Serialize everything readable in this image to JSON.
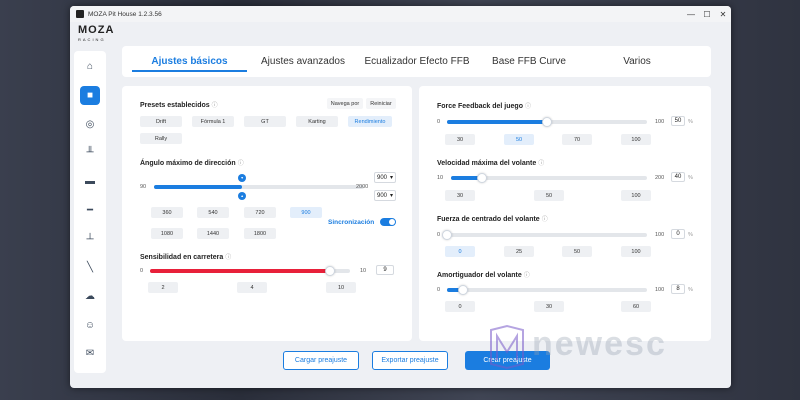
{
  "window": {
    "title": "MOZA Pit House 1.2.3.56"
  },
  "logo": {
    "brand": "MOZA",
    "sub": "RACING"
  },
  "sidebar": {
    "items": [
      {
        "icon": "home-icon",
        "glyph": "⌂"
      },
      {
        "icon": "wheelbase-icon",
        "glyph": "■"
      },
      {
        "icon": "steering-wheel-icon",
        "glyph": "◎"
      },
      {
        "icon": "pedals-icon",
        "glyph": "╨"
      },
      {
        "icon": "dashboard-icon",
        "glyph": "▬"
      },
      {
        "icon": "handbrake-bar-icon",
        "glyph": "━"
      },
      {
        "icon": "shifter-icon",
        "glyph": "┴"
      },
      {
        "icon": "handbrake-icon",
        "glyph": "╲"
      },
      {
        "icon": "cloud-icon",
        "glyph": "☁"
      },
      {
        "icon": "support-icon",
        "glyph": "☺"
      },
      {
        "icon": "feedback-icon",
        "glyph": "✉"
      }
    ]
  },
  "tabs": [
    "Ajustes básicos",
    "Ajustes avanzados",
    "Ecualizador Efecto FFB",
    "Base FFB Curve",
    "Varios"
  ],
  "presets": {
    "label": "Presets establecidos",
    "navigate": "Navega por",
    "reset": "Reiniciar",
    "chips": [
      "Drift",
      "Fórmula 1",
      "GT",
      "Karting",
      "Rendimiento",
      "Rally"
    ],
    "selected": "Rendimiento"
  },
  "steering_angle": {
    "label": "Ángulo máximo de dirección",
    "min": "90",
    "max": "2000",
    "value_top": "900",
    "value_bottom": "900",
    "fraction": 0.42,
    "chips": [
      "360",
      "540",
      "720",
      "900",
      "1080",
      "1440",
      "1800"
    ],
    "selected": "900",
    "sync_label": "Sincronización"
  },
  "sensitivity": {
    "label": "Sensibilidad en carretera",
    "min": "0",
    "max": "10",
    "value": "9",
    "fraction": 0.9,
    "chips": [
      "2",
      "4",
      "10"
    ]
  },
  "ffb": {
    "label": "Force Feedback del juego",
    "min": "0",
    "max": "100",
    "value": "50",
    "unit": "%",
    "fraction": 0.5,
    "chips": [
      "30",
      "50",
      "70",
      "100"
    ],
    "selected": "50"
  },
  "max_speed": {
    "label": "Velocidad máxima del volante",
    "min": "10",
    "max": "200",
    "value": "40",
    "unit": "%",
    "fraction": 0.16,
    "chips": [
      "30",
      "50",
      "100"
    ]
  },
  "centering": {
    "label": "Fuerza de centrado del volante",
    "min": "0",
    "max": "100",
    "value": "0",
    "unit": "%",
    "fraction": 0.0,
    "chips": [
      "0",
      "25",
      "50",
      "100"
    ],
    "selected": "0"
  },
  "damper": {
    "label": "Amortiguador del volante",
    "min": "0",
    "max": "100",
    "value": "8",
    "unit": "%",
    "fraction": 0.08,
    "chips": [
      "0",
      "30",
      "60"
    ]
  },
  "footer": {
    "load": "Cargar preajuste",
    "export": "Exportar preajuste",
    "create": "Crear preajuste"
  },
  "watermark": "newesc",
  "colors": {
    "accent": "#1b7de0",
    "red": "#e8203a"
  }
}
